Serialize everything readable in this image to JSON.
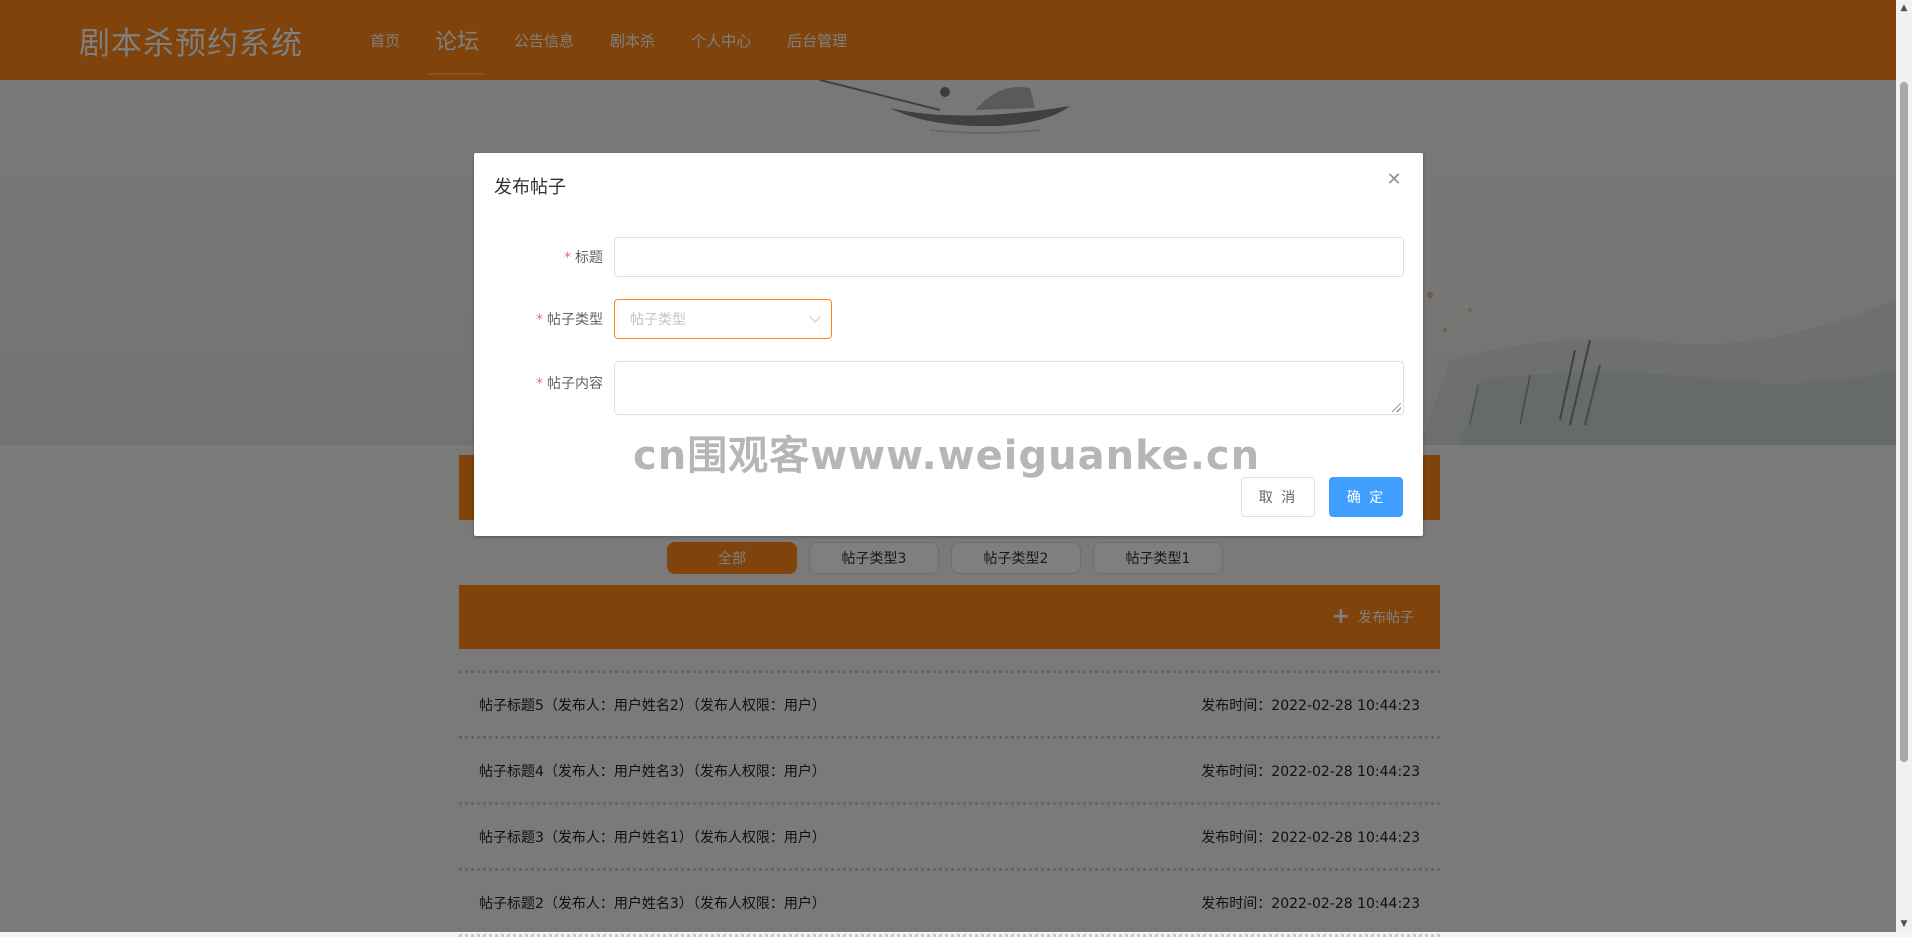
{
  "header": {
    "brand": "剧本杀预约系统",
    "nav": [
      {
        "label": "首页"
      },
      {
        "label": "论坛"
      },
      {
        "label": "公告信息"
      },
      {
        "label": "剧本杀"
      },
      {
        "label": "个人中心"
      },
      {
        "label": "后台管理"
      }
    ],
    "active_nav": "论坛"
  },
  "filters": [
    {
      "label": "全部",
      "active": true
    },
    {
      "label": "帖子类型3",
      "active": false
    },
    {
      "label": "帖子类型2",
      "active": false
    },
    {
      "label": "帖子类型1",
      "active": false
    }
  ],
  "post_bar": {
    "button_label": "发布帖子"
  },
  "posts": [
    {
      "title": "帖子标题5（发布人：用户姓名2）（发布人权限：用户）",
      "time": "发布时间：2022-02-28 10:44:23"
    },
    {
      "title": "帖子标题4（发布人：用户姓名3）（发布人权限：用户）",
      "time": "发布时间：2022-02-28 10:44:23"
    },
    {
      "title": "帖子标题3（发布人：用户姓名1）（发布人权限：用户）",
      "time": "发布时间：2022-02-28 10:44:23"
    },
    {
      "title": "帖子标题2（发布人：用户姓名3）（发布人权限：用户）",
      "time": "发布时间：2022-02-28 10:44:23"
    }
  ],
  "modal": {
    "title": "发布帖子",
    "close_icon": "close-icon",
    "fields": {
      "title_label": "标题",
      "title_value": "",
      "type_label": "帖子类型",
      "type_placeholder": "帖子类型",
      "content_label": "帖子内容",
      "content_value": ""
    },
    "required_mark": "*",
    "cancel_label": "取 消",
    "confirm_label": "确 定",
    "watermark": "cn围观客www.weiguanke.cn"
  },
  "colors": {
    "brand_orange": "#ff8716",
    "primary_blue": "#409eff",
    "required_red": "#f56c6c"
  }
}
